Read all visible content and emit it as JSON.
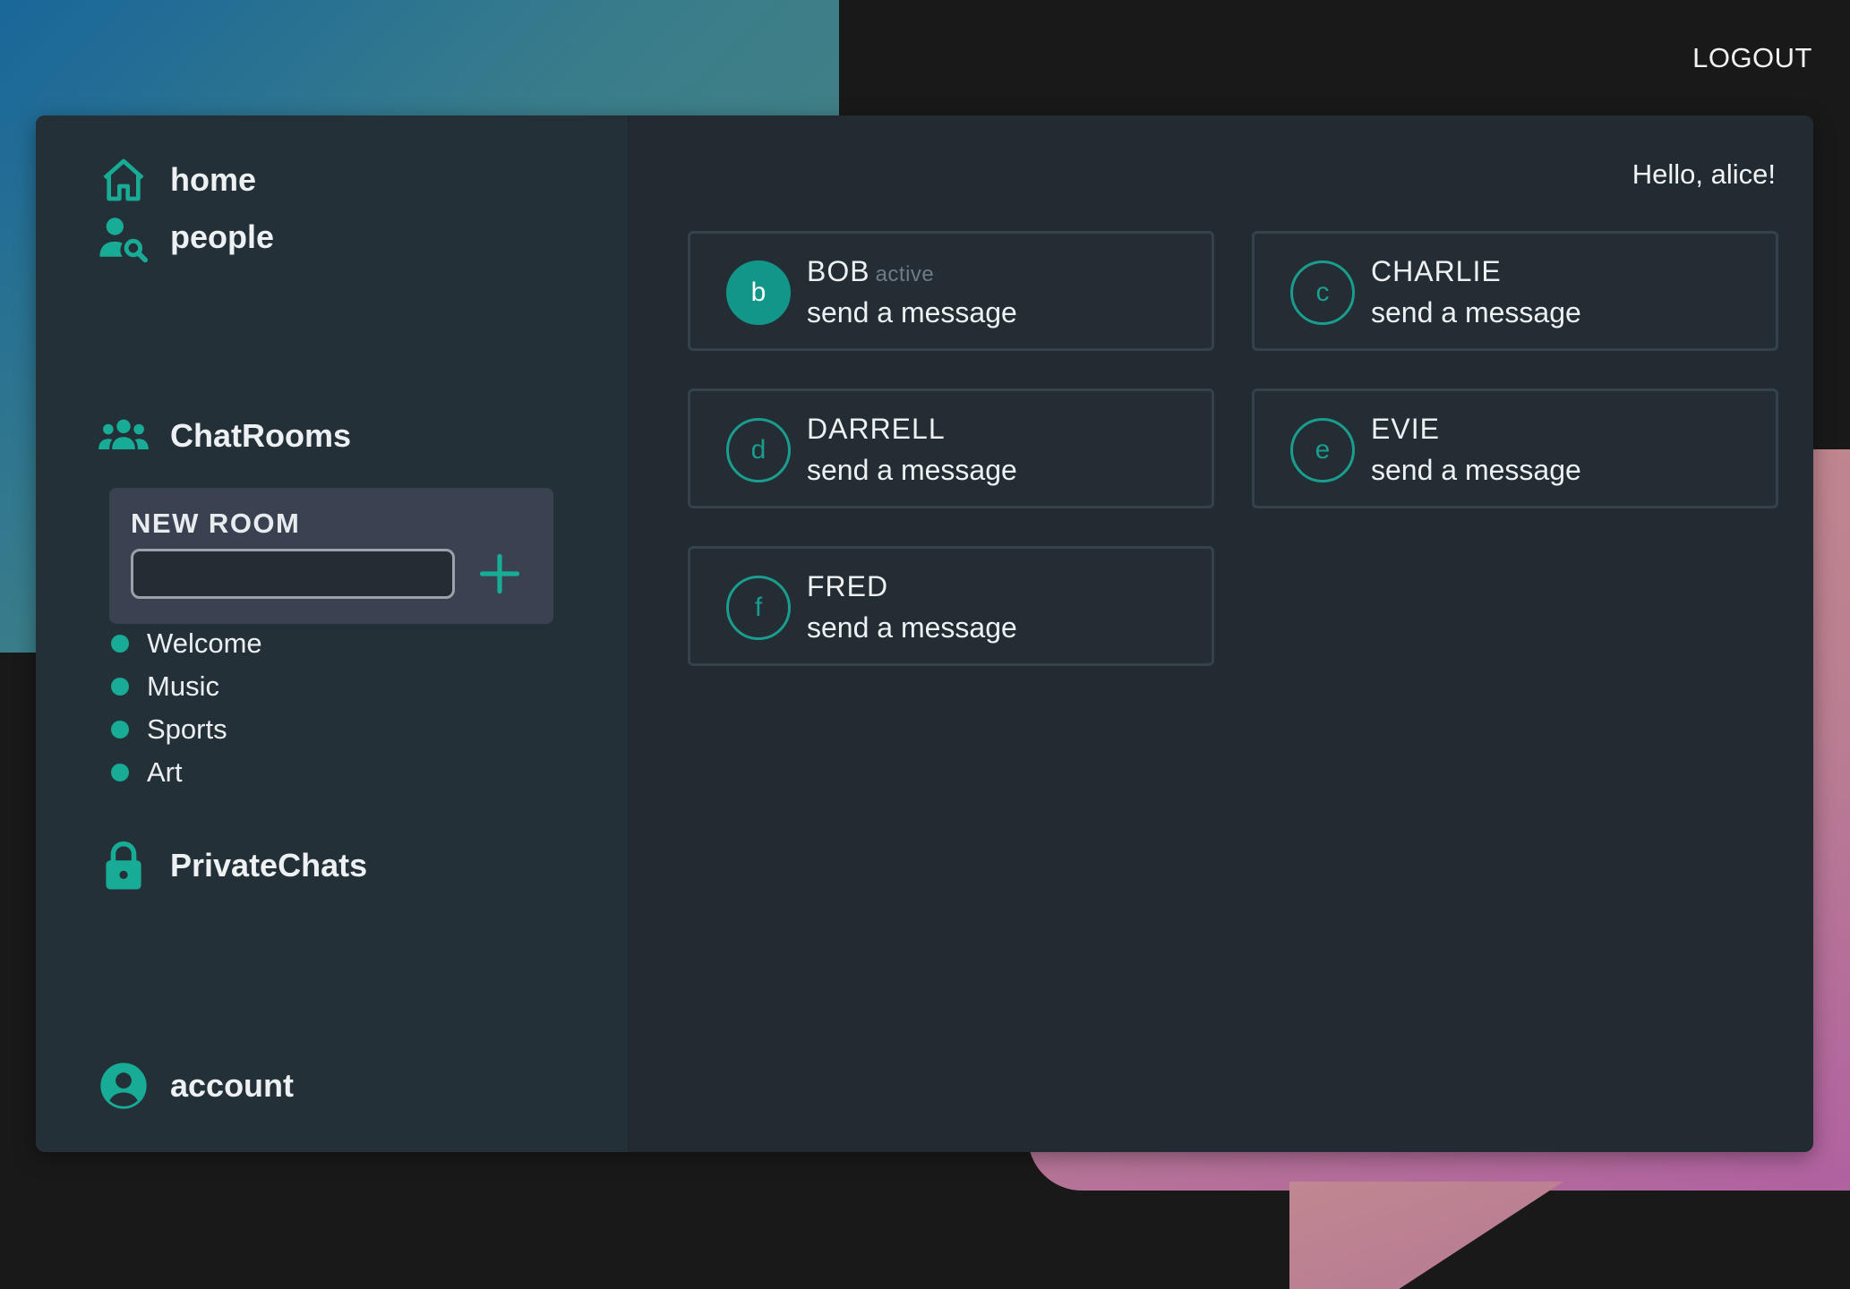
{
  "header": {
    "logout_label": "LOGOUT"
  },
  "sidebar": {
    "nav": {
      "home": "home",
      "people": "people",
      "chatrooms": "ChatRooms",
      "private_chats": "PrivateChats",
      "account": "account"
    },
    "new_room": {
      "title": "NEW ROOM",
      "input_value": "",
      "input_placeholder": ""
    },
    "rooms": [
      "Welcome",
      "Music",
      "Sports",
      "Art"
    ]
  },
  "main": {
    "greeting": "Hello, alice!",
    "users": [
      {
        "initial": "b",
        "name": "BOB",
        "status": "active",
        "action": "send a message"
      },
      {
        "initial": "c",
        "name": "CHARLIE",
        "status": "",
        "action": "send a message"
      },
      {
        "initial": "d",
        "name": "DARRELL",
        "status": "",
        "action": "send a message"
      },
      {
        "initial": "e",
        "name": "EVIE",
        "status": "",
        "action": "send a message"
      },
      {
        "initial": "f",
        "name": "FRED",
        "status": "",
        "action": "send a message"
      }
    ]
  },
  "colors": {
    "accent": "#18ab96",
    "panel": "#222b31",
    "sidebar": "#243037",
    "new_room_box": "#3a4151"
  },
  "icons": [
    "home-icon",
    "people-search-icon",
    "group-icon",
    "lock-icon",
    "account-circle-icon",
    "plus-icon"
  ]
}
